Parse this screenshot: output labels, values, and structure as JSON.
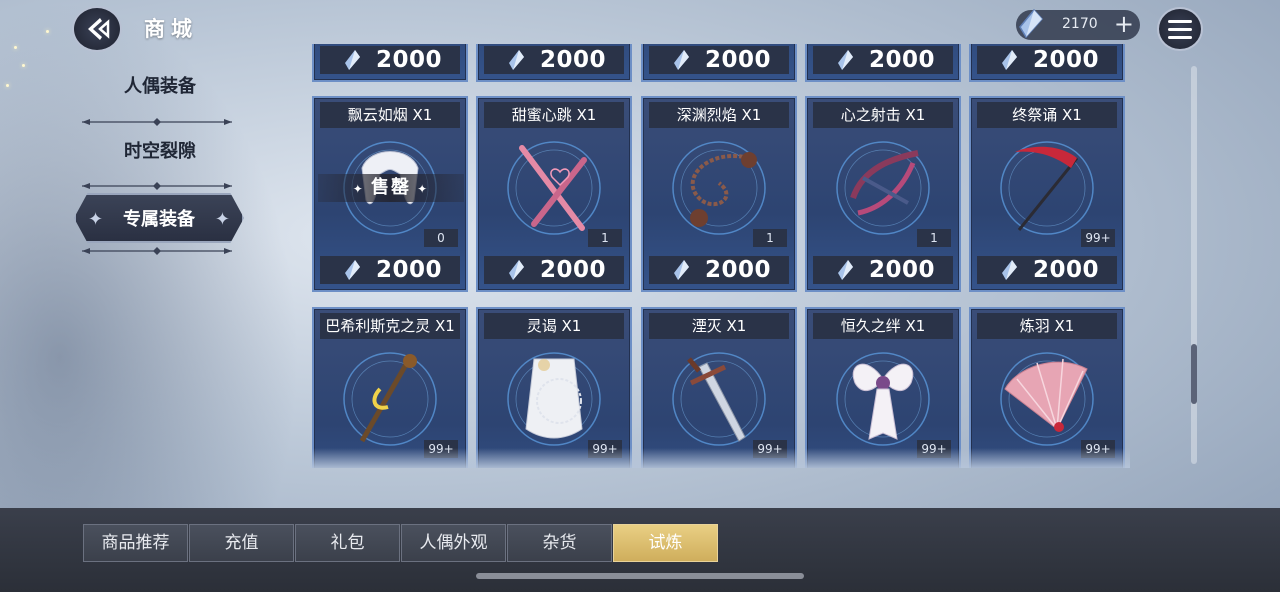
{
  "header": {
    "title": "商城",
    "currency": {
      "value": "2170",
      "icon": "crystal-icon",
      "add_icon": "plus-icon"
    }
  },
  "sidebar": {
    "items": [
      {
        "label": "人偶装备",
        "active": false
      },
      {
        "label": "时空裂隙",
        "active": false
      },
      {
        "label": "专属装备",
        "active": true
      }
    ]
  },
  "top_row_prices": [
    "2000",
    "2000",
    "2000",
    "2000",
    "2000"
  ],
  "items_row1": [
    {
      "name": "飘云如烟 X1",
      "qty": "0",
      "price": "2000",
      "sold_label": "售罄",
      "art": "white-feather-accessory"
    },
    {
      "name": "甜蜜心跳 X1",
      "qty": "1",
      "price": "2000",
      "art": "pink-drumsticks"
    },
    {
      "name": "深渊烈焰 X1",
      "qty": "1",
      "price": "2000",
      "art": "chain-flail"
    },
    {
      "name": "心之射击 X1",
      "qty": "1",
      "price": "2000",
      "art": "crossbow"
    },
    {
      "name": "终祭诵 X1",
      "qty": "99+",
      "price": "2000",
      "art": "scythe"
    }
  ],
  "items_row2": [
    {
      "name": "巴希利斯克之灵 X1",
      "qty": "99+",
      "art": "serpent-staff"
    },
    {
      "name": "灵谒 X1",
      "qty": "99+",
      "art": "lace-dress"
    },
    {
      "name": "湮灭 X1",
      "qty": "99+",
      "art": "sword"
    },
    {
      "name": "恒久之绊 X1",
      "qty": "99+",
      "art": "bow-ribbon"
    },
    {
      "name": "炼羽 X1",
      "qty": "99+",
      "art": "feather-fan"
    }
  ],
  "bottom_tabs": [
    {
      "label": "商品推荐",
      "active": false
    },
    {
      "label": "充值",
      "active": false
    },
    {
      "label": "礼包",
      "active": false
    },
    {
      "label": "人偶外观",
      "active": false
    },
    {
      "label": "杂货",
      "active": false
    },
    {
      "label": "试炼",
      "active": true
    }
  ],
  "colors": {
    "accent_gold": "#d9bb6a",
    "card_blue": "#2d4472",
    "card_border": "#6d8fc6"
  }
}
